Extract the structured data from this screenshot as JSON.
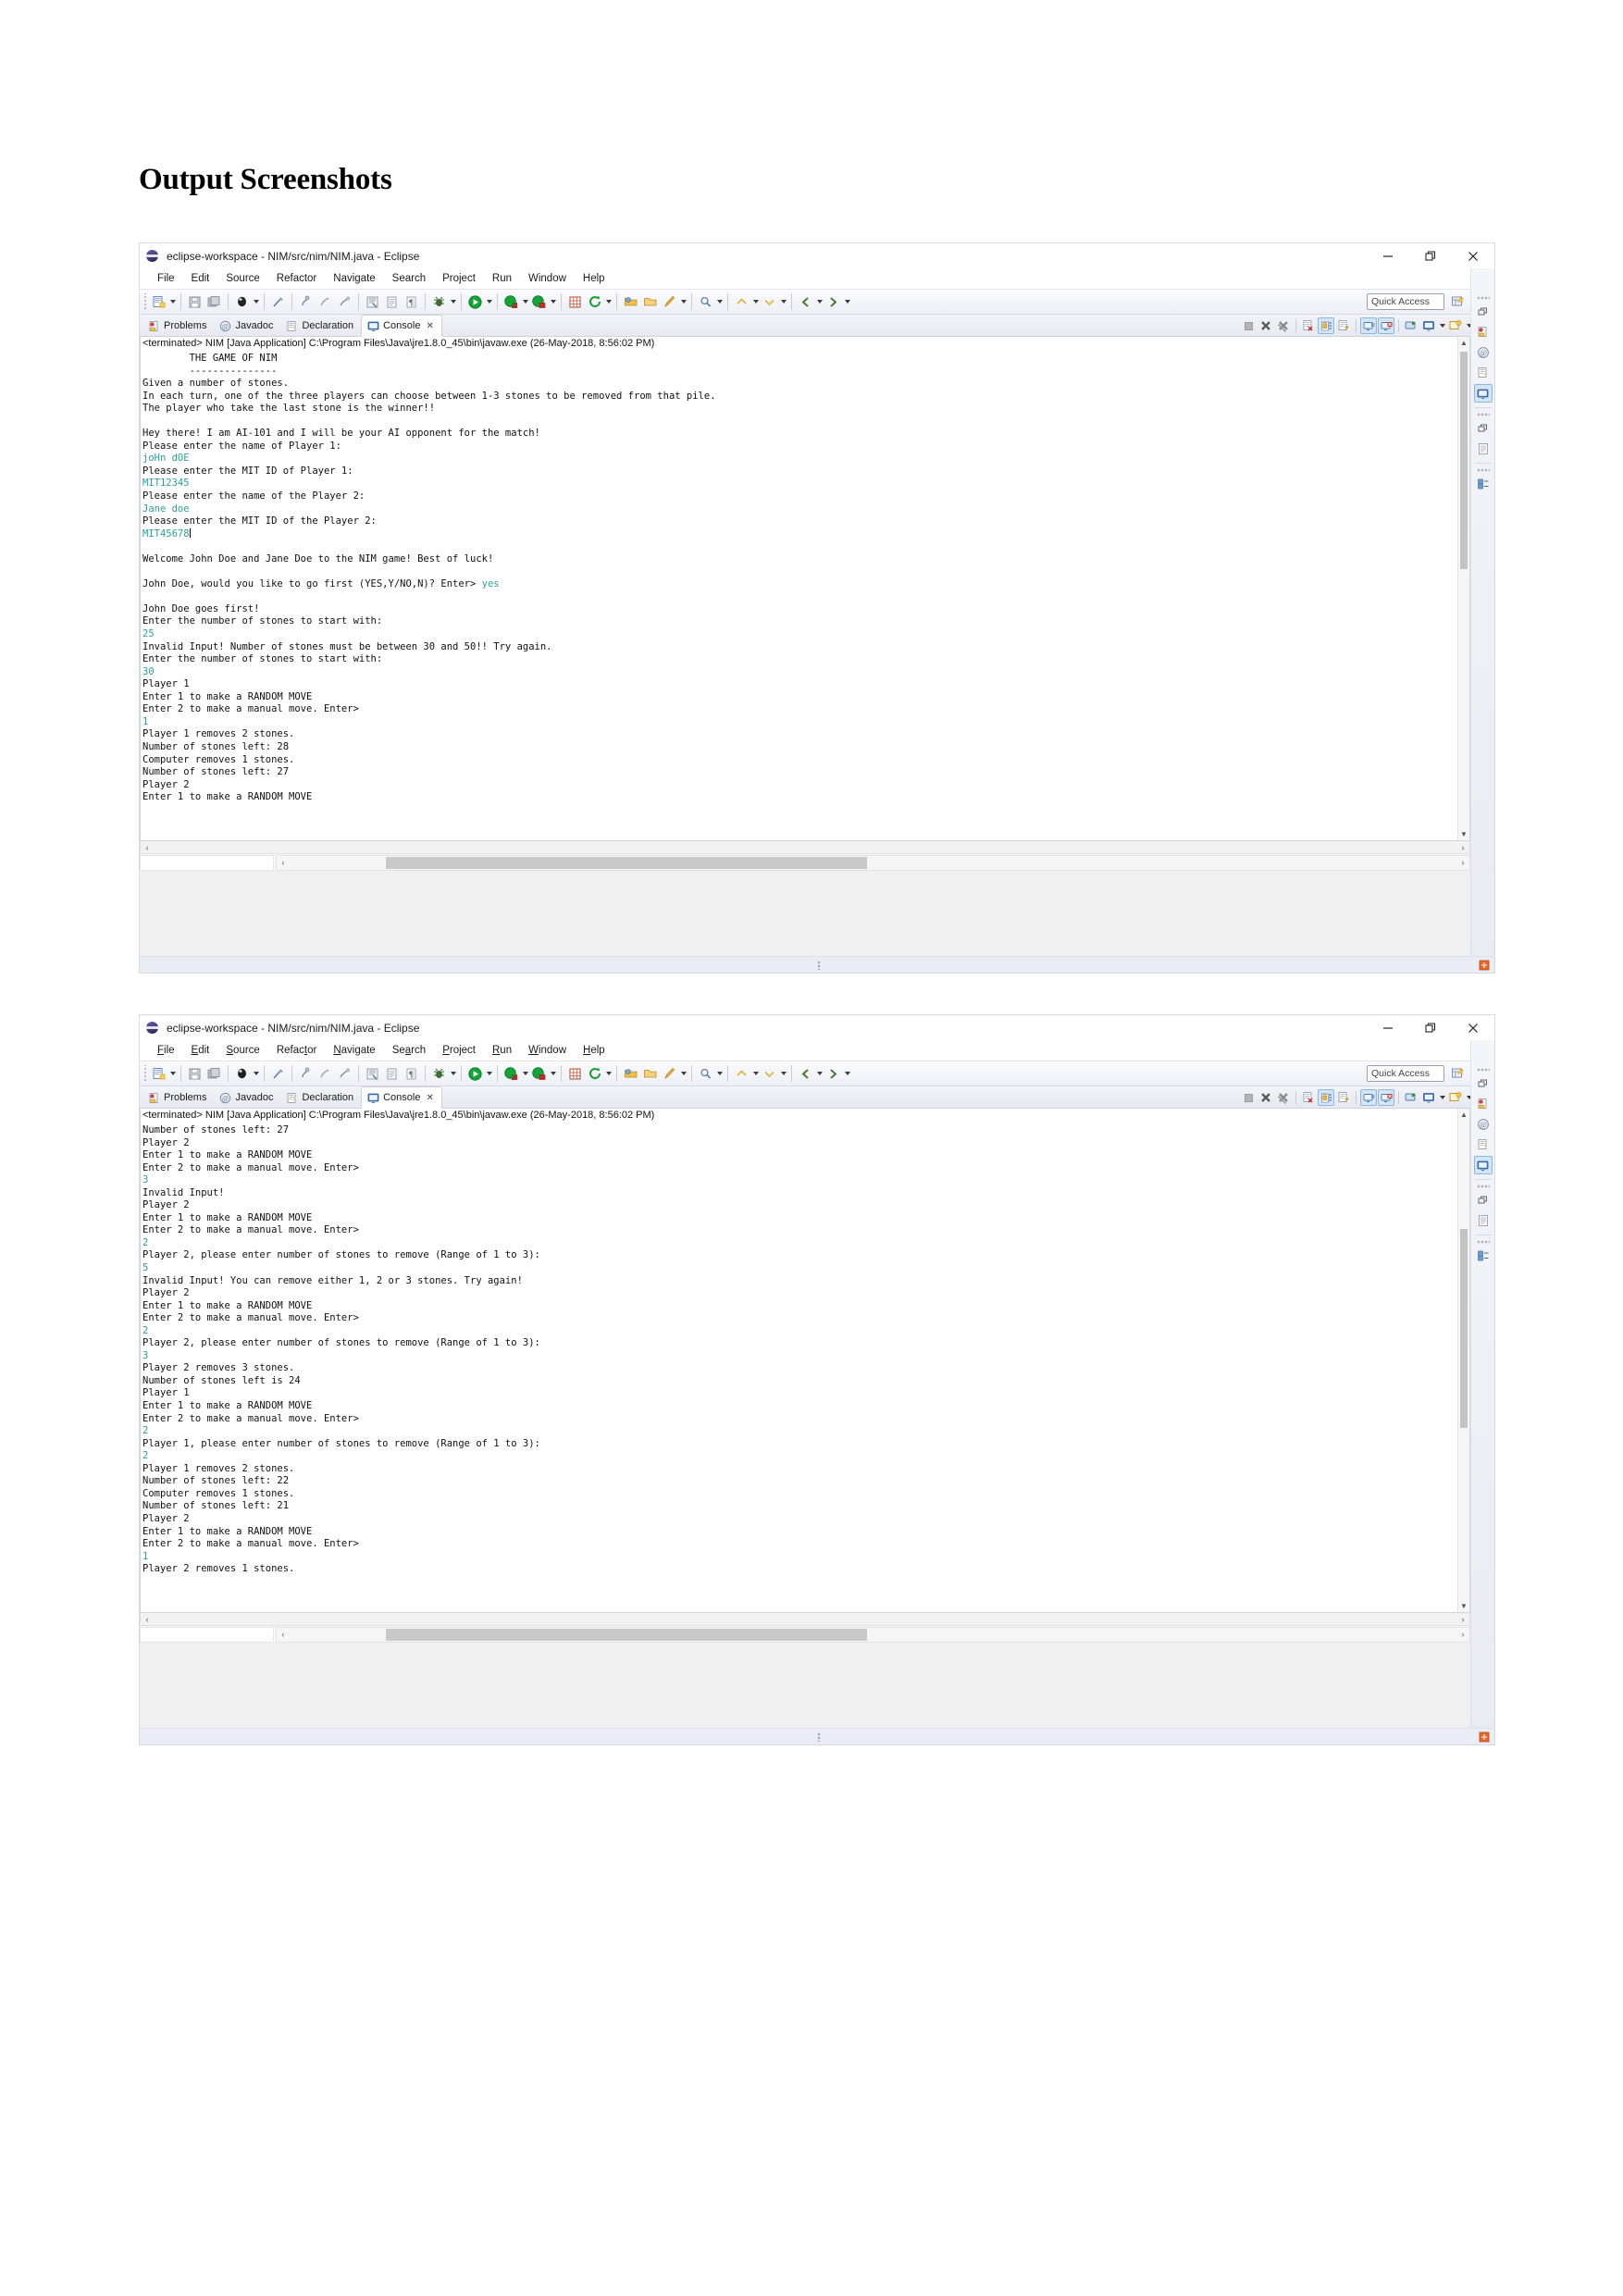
{
  "document": {
    "heading": "Output Screenshots"
  },
  "window": {
    "title": "eclipse-workspace - NIM/src/nim/NIM.java - Eclipse",
    "controls": {
      "minimize": "minimize-icon",
      "restore": "restore-icon",
      "close": "close-icon"
    },
    "menu": [
      {
        "label": "File",
        "mnemonic": "F"
      },
      {
        "label": "Edit",
        "mnemonic": "E"
      },
      {
        "label": "Source",
        "mnemonic": "S"
      },
      {
        "label": "Refactor",
        "mnemonic": "t"
      },
      {
        "label": "Navigate",
        "mnemonic": "N"
      },
      {
        "label": "Search",
        "mnemonic": "a"
      },
      {
        "label": "Project",
        "mnemonic": "P"
      },
      {
        "label": "Run",
        "mnemonic": "R"
      },
      {
        "label": "Window",
        "mnemonic": "W"
      },
      {
        "label": "Help",
        "mnemonic": "H"
      }
    ],
    "toolbar": {
      "quick_access_placeholder": "Quick Access",
      "icons": [
        "new-wizard-icon",
        "save-icon",
        "save-all-icon",
        "print-icon",
        "toggle-mark-occurrences-icon",
        "new-java-project-icon",
        "new-package-icon",
        "new-class-icon",
        "open-type-icon",
        "open-task-icon",
        "last-edit-location-icon",
        "debug-icon",
        "run-icon",
        "external-tools-icon",
        "coverage-icon",
        "new-junit-test-icon",
        "refresh-icon",
        "open-perspective-icon",
        "open-resource-icon",
        "pin-editor-icon",
        "search-icon",
        "previous-annotation-icon",
        "next-annotation-icon",
        "back-icon",
        "forward-icon"
      ],
      "right_icons": [
        "new-perspective-icon",
        "java-perspective-icon"
      ]
    },
    "view_tabs": [
      {
        "label": "Problems",
        "icon": "problems-icon",
        "active": false,
        "closable": false
      },
      {
        "label": "Javadoc",
        "icon": "javadoc-icon",
        "active": false,
        "closable": false
      },
      {
        "label": "Declaration",
        "icon": "declaration-icon",
        "active": false,
        "closable": false
      },
      {
        "label": "Console",
        "icon": "console-icon",
        "active": true,
        "closable": true
      }
    ],
    "view_toolbar_icons": [
      "terminate-icon",
      "remove-launch-icon",
      "remove-all-terminated-icon",
      "clear-console-icon",
      "scroll-lock-icon",
      "word-wrap-icon",
      "show-console-on-output-icon",
      "show-console-on-error-icon",
      "pin-console-icon",
      "display-selected-console-icon",
      "select-dropdown-icon",
      "open-console-icon",
      "open-console-dropdown-icon",
      "view-menu-icon"
    ],
    "fastview_icons": [
      "java-perspective-icon",
      "restore-icon",
      "problems-icon",
      "javadoc-icon",
      "declaration-icon",
      "console-icon",
      "restore-icon",
      "outline-icon",
      "restore-icon",
      "package-explorer-icon"
    ],
    "statusbar_icon": "smart-insert-icon"
  },
  "console": {
    "header": "<terminated> NIM [Java Application] C:\\Program Files\\Java\\jre1.8.0_45\\bin\\javaw.exe (26-May-2018, 8:56:02 PM)",
    "input_color": "#2aa198",
    "output_color": "#111111"
  },
  "screenshot_1": {
    "lines": [
      {
        "t": "        THE GAME OF NIM",
        "k": "out"
      },
      {
        "t": "        ---------------",
        "k": "out"
      },
      {
        "t": "Given a number of stones.",
        "k": "out"
      },
      {
        "t": "In each turn, one of the three players can choose between 1-3 stones to be removed from that pile.",
        "k": "out"
      },
      {
        "t": "The player who take the last stone is the winner!!",
        "k": "out"
      },
      {
        "t": "",
        "k": "out"
      },
      {
        "t": "Hey there! I am AI-101 and I will be your AI opponent for the match!",
        "k": "out"
      },
      {
        "t": "Please enter the name of Player 1:",
        "k": "out"
      },
      {
        "t": "joHn dOE",
        "k": "in"
      },
      {
        "t": "Please enter the MIT ID of Player 1:",
        "k": "out"
      },
      {
        "t": "MIT12345",
        "k": "in"
      },
      {
        "t": "Please enter the name of the Player 2:",
        "k": "out"
      },
      {
        "t": "Jane doe",
        "k": "in"
      },
      {
        "t": "Please enter the MIT ID of the Player 2:",
        "k": "out"
      },
      {
        "t": "MIT45678",
        "k": "in-cursor"
      },
      {
        "t": "",
        "k": "out"
      },
      {
        "t": "Welcome John Doe and Jane Doe to the NIM game! Best of luck!",
        "k": "out"
      },
      {
        "t": "",
        "k": "out"
      },
      {
        "t": "John Doe, would you like to go first (YES,Y/NO,N)? Enter> ",
        "k": "out",
        "suffix": "yes"
      },
      {
        "t": "",
        "k": "out"
      },
      {
        "t": "John Doe goes first!",
        "k": "out"
      },
      {
        "t": "Enter the number of stones to start with:",
        "k": "out"
      },
      {
        "t": "25",
        "k": "in"
      },
      {
        "t": "Invalid Input! Number of stones must be between 30 and 50!! Try again.",
        "k": "out"
      },
      {
        "t": "Enter the number of stones to start with:",
        "k": "out"
      },
      {
        "t": "30",
        "k": "in"
      },
      {
        "t": "Player 1",
        "k": "out"
      },
      {
        "t": "Enter 1 to make a RANDOM MOVE",
        "k": "out"
      },
      {
        "t": "Enter 2 to make a manual move. Enter>",
        "k": "out"
      },
      {
        "t": "1",
        "k": "in"
      },
      {
        "t": "Player 1 removes 2 stones.",
        "k": "out"
      },
      {
        "t": "Number of stones left: 28",
        "k": "out"
      },
      {
        "t": "Computer removes 1 stones.",
        "k": "out"
      },
      {
        "t": "Number of stones left: 27",
        "k": "out"
      },
      {
        "t": "Player 2",
        "k": "out"
      },
      {
        "t": "Enter 1 to make a RANDOM MOVE",
        "k": "out"
      }
    ]
  },
  "screenshot_2": {
    "lines": [
      {
        "t": "Number of stones left: 27",
        "k": "out"
      },
      {
        "t": "Player 2",
        "k": "out"
      },
      {
        "t": "Enter 1 to make a RANDOM MOVE",
        "k": "out"
      },
      {
        "t": "Enter 2 to make a manual move. Enter>",
        "k": "out"
      },
      {
        "t": "3",
        "k": "in"
      },
      {
        "t": "Invalid Input!",
        "k": "out"
      },
      {
        "t": "Player 2",
        "k": "out"
      },
      {
        "t": "Enter 1 to make a RANDOM MOVE",
        "k": "out"
      },
      {
        "t": "Enter 2 to make a manual move. Enter>",
        "k": "out"
      },
      {
        "t": "2",
        "k": "in"
      },
      {
        "t": "Player 2, please enter number of stones to remove (Range of 1 to 3):",
        "k": "out"
      },
      {
        "t": "5",
        "k": "in"
      },
      {
        "t": "Invalid Input! You can remove either 1, 2 or 3 stones. Try again!",
        "k": "out"
      },
      {
        "t": "Player 2",
        "k": "out"
      },
      {
        "t": "Enter 1 to make a RANDOM MOVE",
        "k": "out"
      },
      {
        "t": "Enter 2 to make a manual move. Enter>",
        "k": "out"
      },
      {
        "t": "2",
        "k": "in"
      },
      {
        "t": "Player 2, please enter number of stones to remove (Range of 1 to 3):",
        "k": "out"
      },
      {
        "t": "3",
        "k": "in"
      },
      {
        "t": "Player 2 removes 3 stones.",
        "k": "out"
      },
      {
        "t": "Number of stones left is 24",
        "k": "out"
      },
      {
        "t": "Player 1",
        "k": "out"
      },
      {
        "t": "Enter 1 to make a RANDOM MOVE",
        "k": "out"
      },
      {
        "t": "Enter 2 to make a manual move. Enter>",
        "k": "out"
      },
      {
        "t": "2",
        "k": "in"
      },
      {
        "t": "Player 1, please enter number of stones to remove (Range of 1 to 3):",
        "k": "out"
      },
      {
        "t": "2",
        "k": "in"
      },
      {
        "t": "Player 1 removes 2 stones.",
        "k": "out"
      },
      {
        "t": "Number of stones left: 22",
        "k": "out"
      },
      {
        "t": "Computer removes 1 stones.",
        "k": "out"
      },
      {
        "t": "Number of stones left: 21",
        "k": "out"
      },
      {
        "t": "Player 2",
        "k": "out"
      },
      {
        "t": "Enter 1 to make a RANDOM MOVE",
        "k": "out"
      },
      {
        "t": "Enter 2 to make a manual move. Enter>",
        "k": "out"
      },
      {
        "t": "1",
        "k": "in"
      },
      {
        "t": "Player 2 removes 1 stones.",
        "k": "out"
      }
    ]
  }
}
